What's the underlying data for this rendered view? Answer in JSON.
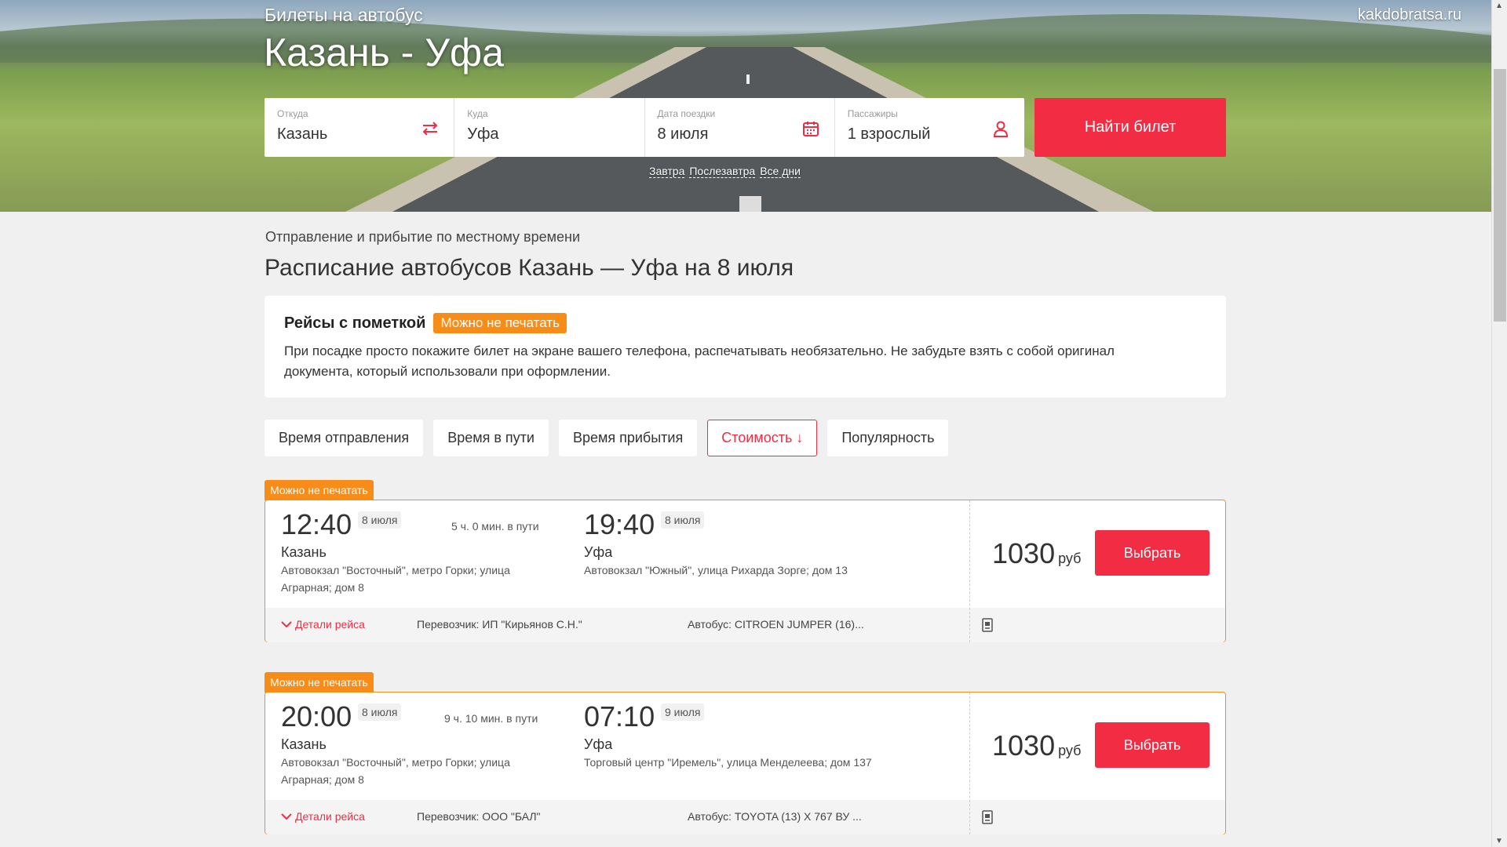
{
  "hero": {
    "watermark": "kakdobratsa.ru",
    "subtitle": "Билеты на автобус",
    "title": "Казань - Уфа"
  },
  "search": {
    "from": {
      "label": "Откуда",
      "value": "Казань",
      "icon": "swap-icon"
    },
    "to": {
      "label": "Куда",
      "value": "Уфа"
    },
    "date": {
      "label": "Дата поездки",
      "value": "8 июля",
      "icon": "calendar-icon"
    },
    "passengers": {
      "label": "Пассажиры",
      "value": "1 взрослый",
      "icon": "person-icon"
    },
    "find_label": "Найти билет",
    "quick_dates": [
      "Завтра",
      "Послезавтра",
      "Все дни"
    ]
  },
  "local_time_note": "Отправление и прибытие по местному времени",
  "heading": "Расписание автобусов Казань — Уфа на 8 июля",
  "info": {
    "title": "Рейсы с пометкой",
    "badge": "Можно не печатать",
    "text": "При посадке просто покажите билет на экране вашего телефона, распечатывать необязательно. Не забудьте взять с собой оригинал документа, который использовали при оформлении."
  },
  "sort": [
    {
      "label": "Время отправления",
      "active": false
    },
    {
      "label": "Время в пути",
      "active": false
    },
    {
      "label": "Время прибытия",
      "active": false
    },
    {
      "label": "Стоимость ↓",
      "active": true
    },
    {
      "label": "Популярность",
      "active": false
    }
  ],
  "trips": [
    {
      "tag": "Можно не печатать",
      "dep_time": "12:40",
      "dep_date": "8 июля",
      "duration": "5 ч. 0 мин. в пути",
      "dep_city": "Казань",
      "dep_addr_1": "Автовокзал \"Восточный\", метро Горки; улица",
      "dep_addr_2": "Аграрная; дом 8",
      "arr_time": "19:40",
      "arr_date": "8 июля",
      "arr_city": "Уфа",
      "arr_addr": "Автовокзал \"Южный\", улица Рихарда Зорге; дом 13",
      "price": "1030",
      "currency": "руб",
      "select_label": "Выбрать",
      "details_label": "Детали рейса",
      "carrier": "Перевозчик: ИП \"Кирьянов С.Н.\"",
      "bus": "Автобус: CITROEN JUMPER (16)..."
    },
    {
      "tag": "Можно не печатать",
      "dep_time": "20:00",
      "dep_date": "8 июля",
      "duration": "9 ч. 10 мин. в пути",
      "dep_city": "Казань",
      "dep_addr_1": "Автовокзал \"Восточный\", метро Горки; улица",
      "dep_addr_2": "Аграрная; дом 8",
      "arr_time": "07:10",
      "arr_date": "9 июля",
      "arr_city": "Уфа",
      "arr_addr": "Торговый центр \"Иремель\", улица Менделеева; дом 137",
      "price": "1030",
      "currency": "руб",
      "select_label": "Выбрать",
      "details_label": "Детали рейса",
      "carrier": "Перевозчик: ООО \"БАЛ\"",
      "bus": "Автобус: TOYOTA (13) Х 767 ВУ ..."
    }
  ]
}
